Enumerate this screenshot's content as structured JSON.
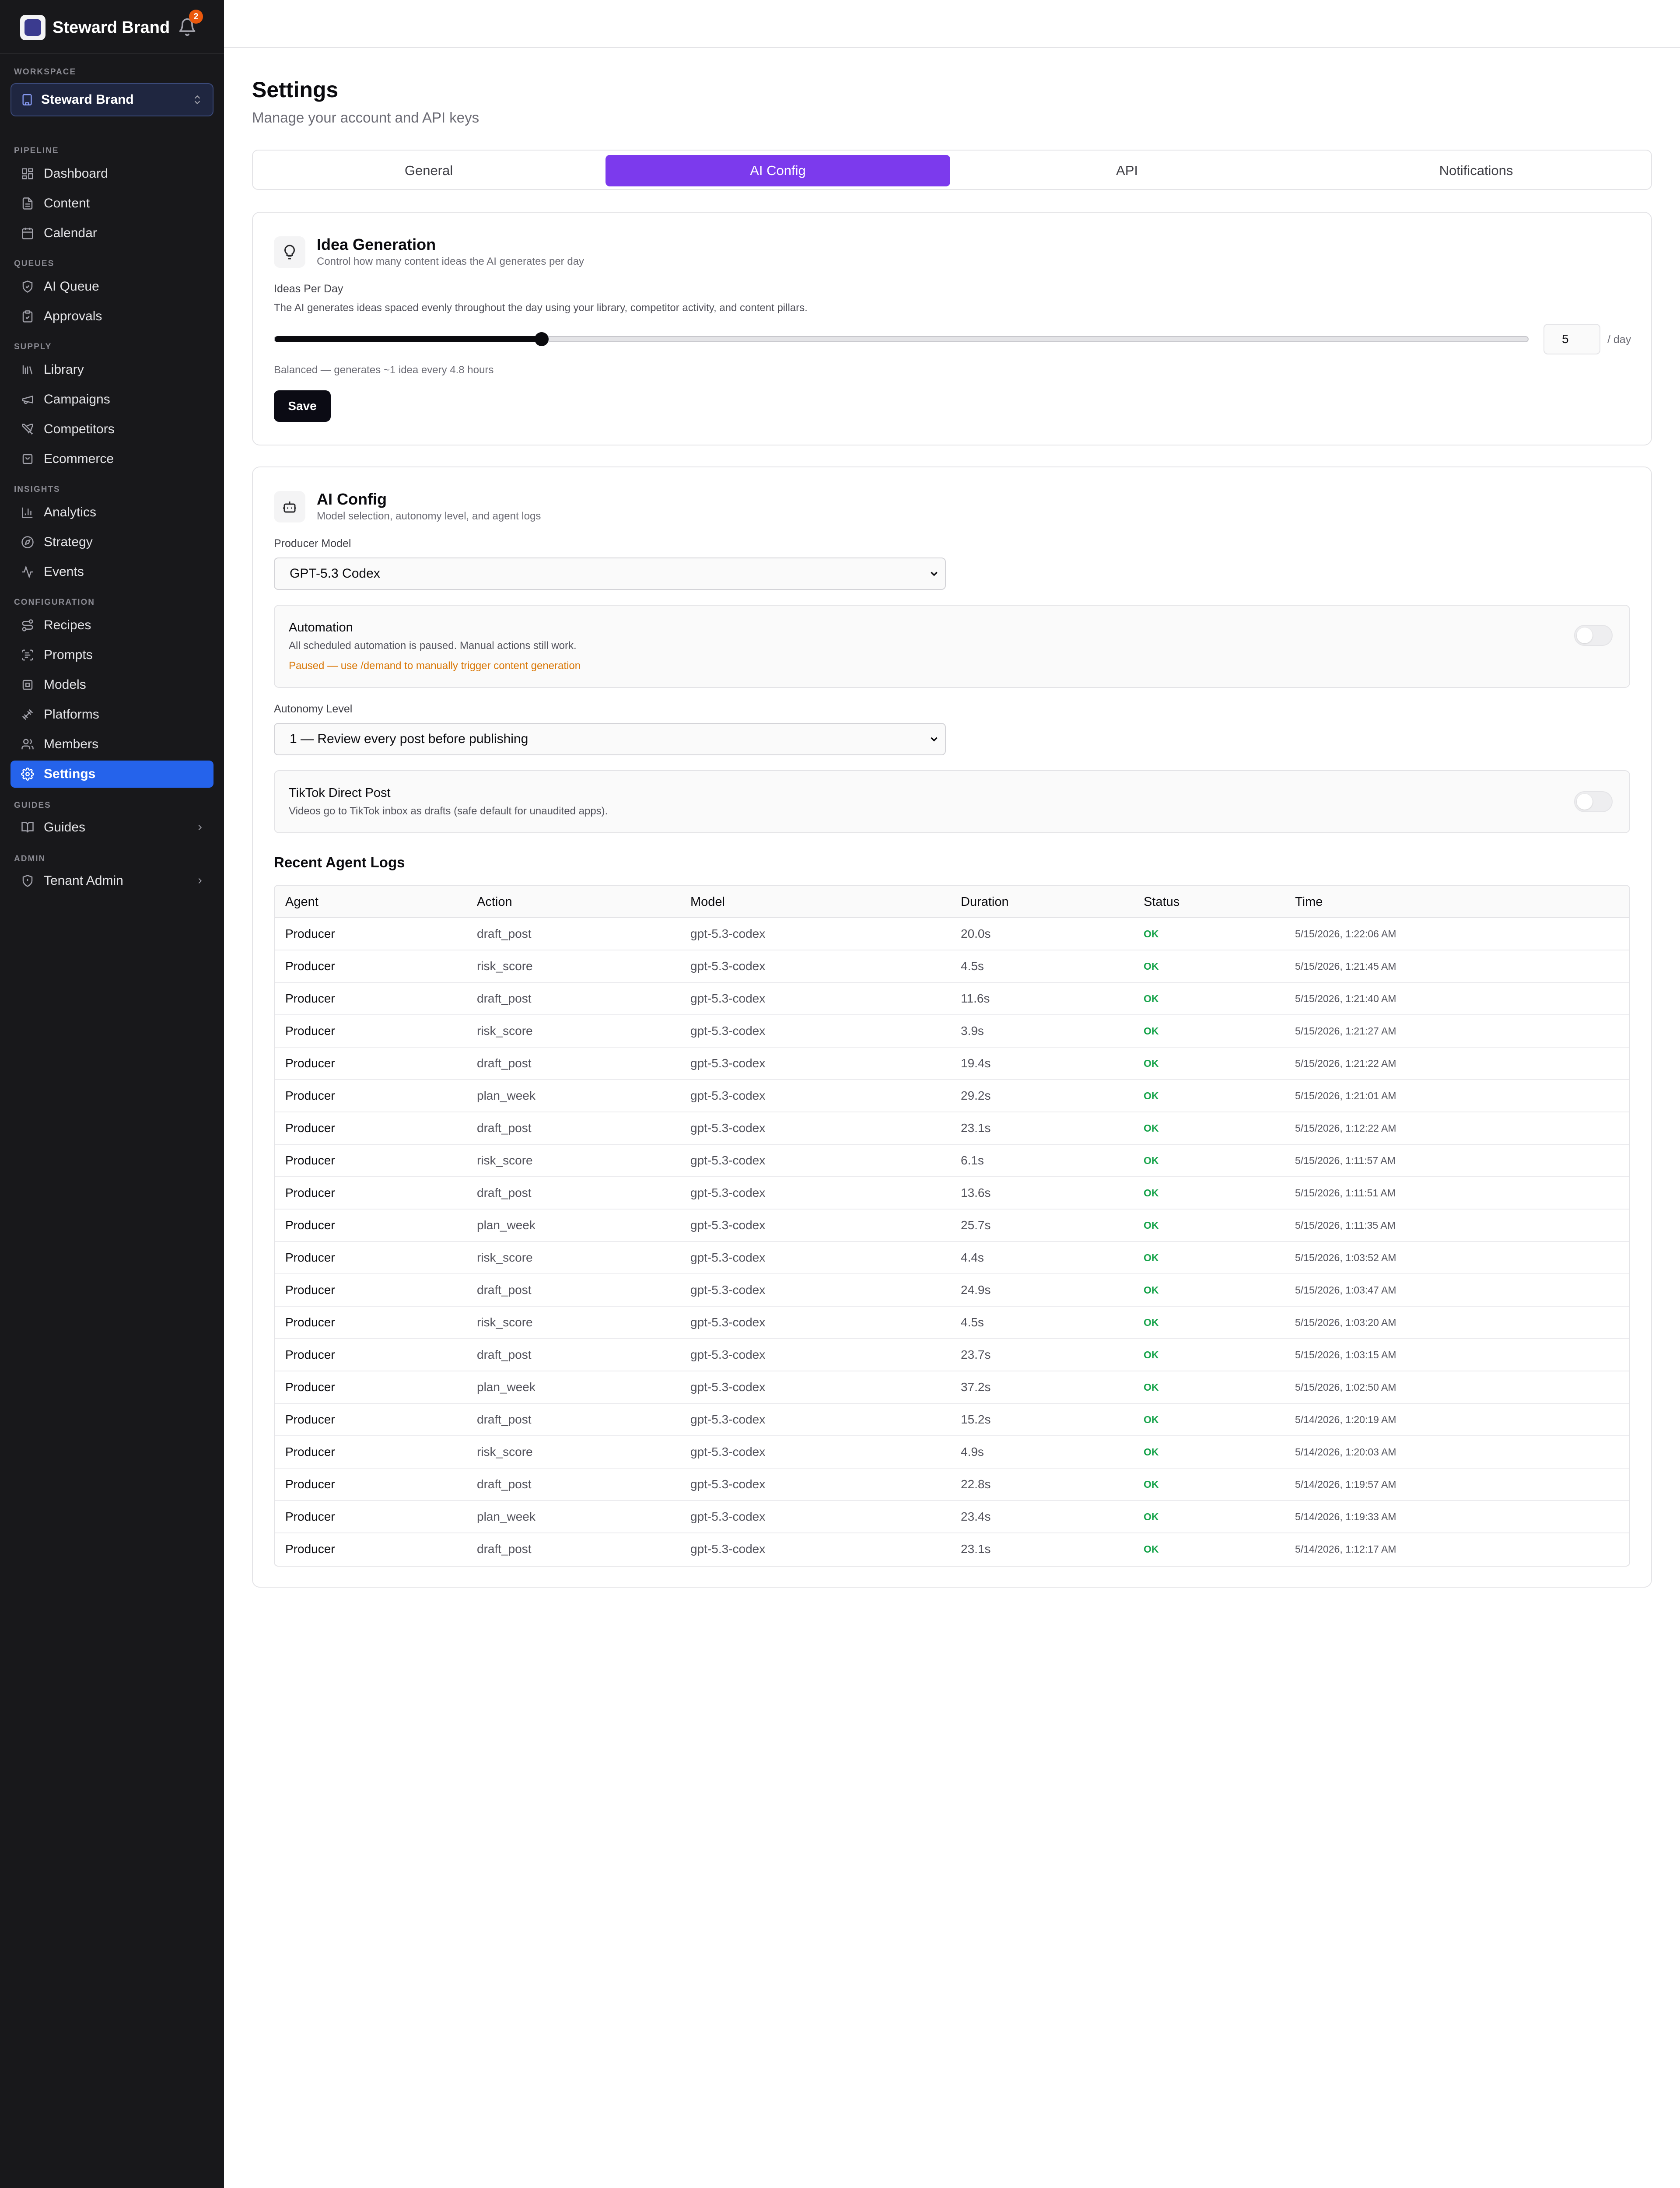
{
  "sidebar": {
    "brand_name": "Steward Brand",
    "brand_logo": "brand-logo",
    "notification_icon": "bell-icon",
    "notification_count": "2",
    "workspace_label": "Workspace",
    "workspace_name": "Steward Brand",
    "sections": {
      "pipeline": "Pipeline",
      "queues": "Queues",
      "supply": "Supply",
      "insights": "Insights",
      "configuration": "Configuration",
      "guides": "Guides",
      "admin": "Admin"
    },
    "items": {
      "dashboard": "Dashboard",
      "content": "Content",
      "calendar": "Calendar",
      "ai_queue": "AI Queue",
      "approvals": "Approvals",
      "library": "Library",
      "campaigns": "Campaigns",
      "competitors": "Competitors",
      "ecommerce": "Ecommerce",
      "analytics": "Analytics",
      "strategy": "Strategy",
      "events": "Events",
      "recipes": "Recipes",
      "prompts": "Prompts",
      "models": "Models",
      "platforms": "Platforms",
      "members": "Members",
      "settings": "Settings",
      "guides": "Guides",
      "tenant_admin": "Tenant Admin"
    },
    "active_item": "settings",
    "active_color": "#2563eb"
  },
  "page": {
    "title": "Settings",
    "subtitle": "Manage your account and API keys"
  },
  "tabs": {
    "general": "General",
    "ai_config": "AI Config",
    "api": "API",
    "notifications": "Notifications",
    "active": "ai_config",
    "active_color": "#7c3aed"
  },
  "idea_generation": {
    "title": "Idea Generation",
    "description": "Control how many content ideas the AI generates per day",
    "field_label": "Ideas Per Day",
    "help": "The AI generates ideas spaced evenly throughout the day using your library, competitor activity, and content pillars.",
    "value": "5",
    "slider_fraction": 0.213,
    "unit": "/ day",
    "hint": "Balanced — generates ~1 idea every 4.8 hours",
    "save_label": "Save"
  },
  "ai_config": {
    "title": "AI Config",
    "description": "Model selection, autonomy level, and agent logs",
    "producer_model_label": "Producer Model",
    "producer_model_value": "GPT-5.3 Codex",
    "automation": {
      "title": "Automation",
      "description": "All scheduled automation is paused. Manual actions still work.",
      "warning": "Paused — use /demand to manually trigger content generation",
      "enabled": false
    },
    "autonomy_label": "Autonomy Level",
    "autonomy_value": "1 — Review every post before publishing",
    "tiktok": {
      "title": "TikTok Direct Post",
      "description": "Videos go to TikTok inbox as drafts (safe default for unaudited apps).",
      "enabled": false
    }
  },
  "logs": {
    "title": "Recent Agent Logs",
    "columns": [
      "Agent",
      "Action",
      "Model",
      "Duration",
      "Status",
      "Time"
    ],
    "rows": [
      [
        "Producer",
        "draft_post",
        "gpt-5.3-codex",
        "20.0s",
        "OK",
        "5/15/2026, 1:22:06 AM"
      ],
      [
        "Producer",
        "risk_score",
        "gpt-5.3-codex",
        "4.5s",
        "OK",
        "5/15/2026, 1:21:45 AM"
      ],
      [
        "Producer",
        "draft_post",
        "gpt-5.3-codex",
        "11.6s",
        "OK",
        "5/15/2026, 1:21:40 AM"
      ],
      [
        "Producer",
        "risk_score",
        "gpt-5.3-codex",
        "3.9s",
        "OK",
        "5/15/2026, 1:21:27 AM"
      ],
      [
        "Producer",
        "draft_post",
        "gpt-5.3-codex",
        "19.4s",
        "OK",
        "5/15/2026, 1:21:22 AM"
      ],
      [
        "Producer",
        "plan_week",
        "gpt-5.3-codex",
        "29.2s",
        "OK",
        "5/15/2026, 1:21:01 AM"
      ],
      [
        "Producer",
        "draft_post",
        "gpt-5.3-codex",
        "23.1s",
        "OK",
        "5/15/2026, 1:12:22 AM"
      ],
      [
        "Producer",
        "risk_score",
        "gpt-5.3-codex",
        "6.1s",
        "OK",
        "5/15/2026, 1:11:57 AM"
      ],
      [
        "Producer",
        "draft_post",
        "gpt-5.3-codex",
        "13.6s",
        "OK",
        "5/15/2026, 1:11:51 AM"
      ],
      [
        "Producer",
        "plan_week",
        "gpt-5.3-codex",
        "25.7s",
        "OK",
        "5/15/2026, 1:11:35 AM"
      ],
      [
        "Producer",
        "risk_score",
        "gpt-5.3-codex",
        "4.4s",
        "OK",
        "5/15/2026, 1:03:52 AM"
      ],
      [
        "Producer",
        "draft_post",
        "gpt-5.3-codex",
        "24.9s",
        "OK",
        "5/15/2026, 1:03:47 AM"
      ],
      [
        "Producer",
        "risk_score",
        "gpt-5.3-codex",
        "4.5s",
        "OK",
        "5/15/2026, 1:03:20 AM"
      ],
      [
        "Producer",
        "draft_post",
        "gpt-5.3-codex",
        "23.7s",
        "OK",
        "5/15/2026, 1:03:15 AM"
      ],
      [
        "Producer",
        "plan_week",
        "gpt-5.3-codex",
        "37.2s",
        "OK",
        "5/15/2026, 1:02:50 AM"
      ],
      [
        "Producer",
        "draft_post",
        "gpt-5.3-codex",
        "15.2s",
        "OK",
        "5/14/2026, 1:20:19 AM"
      ],
      [
        "Producer",
        "risk_score",
        "gpt-5.3-codex",
        "4.9s",
        "OK",
        "5/14/2026, 1:20:03 AM"
      ],
      [
        "Producer",
        "draft_post",
        "gpt-5.3-codex",
        "22.8s",
        "OK",
        "5/14/2026, 1:19:57 AM"
      ],
      [
        "Producer",
        "plan_week",
        "gpt-5.3-codex",
        "23.4s",
        "OK",
        "5/14/2026, 1:19:33 AM"
      ],
      [
        "Producer",
        "draft_post",
        "gpt-5.3-codex",
        "23.1s",
        "OK",
        "5/14/2026, 1:12:17 AM"
      ]
    ]
  }
}
